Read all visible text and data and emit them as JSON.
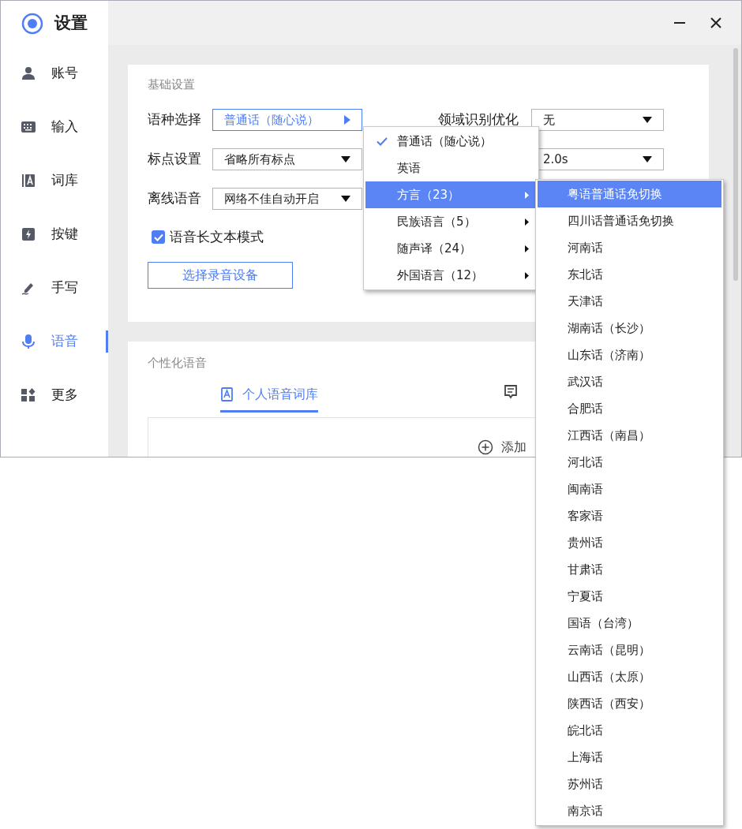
{
  "app": {
    "title": "设置"
  },
  "sidebar": {
    "items": [
      {
        "label": "账号",
        "selected": false
      },
      {
        "label": "输入",
        "selected": false
      },
      {
        "label": "词库",
        "selected": false
      },
      {
        "label": "按键",
        "selected": false
      },
      {
        "label": "手写",
        "selected": false
      },
      {
        "label": "语音",
        "selected": true
      },
      {
        "label": "更多",
        "selected": false
      }
    ]
  },
  "basic_settings": {
    "title": "基础设置",
    "fields": [
      {
        "label": "语种选择",
        "value": "普通话（随心说）",
        "expanded": true
      },
      {
        "label": "标点设置",
        "value": "省略所有标点",
        "expanded": false
      },
      {
        "label": "离线语音",
        "value": "网络不佳自动开启",
        "expanded": false
      }
    ],
    "right_fields": [
      {
        "label": "领域识别优化",
        "value": "无"
      },
      {
        "value": "2.0s"
      }
    ],
    "checkbox": {
      "label": "语音长文本模式",
      "checked": true
    },
    "button": "选择录音设备"
  },
  "personal_voice": {
    "title": "个性化语音",
    "tabs": [
      {
        "label": "个人语音词库",
        "selected": true
      },
      {
        "selected": false
      }
    ],
    "add_button": "添加"
  },
  "language_menu": {
    "items": [
      {
        "label": "普通话（随心说）",
        "checked": true,
        "submenu": false,
        "selected": false
      },
      {
        "label": "英语",
        "checked": false,
        "submenu": false,
        "selected": false
      },
      {
        "label": "方言（23）",
        "checked": false,
        "submenu": true,
        "selected": true
      },
      {
        "label": "民族语言（5）",
        "checked": false,
        "submenu": true,
        "selected": false
      },
      {
        "label": "随声译（24）",
        "checked": false,
        "submenu": true,
        "selected": false
      },
      {
        "label": "外国语言（12）",
        "checked": false,
        "submenu": true,
        "selected": false
      }
    ]
  },
  "dialect_submenu": {
    "items": [
      {
        "label": "粤语普通话免切换",
        "selected": true
      },
      {
        "label": "四川话普通话免切换",
        "selected": false
      },
      {
        "label": "河南话",
        "selected": false
      },
      {
        "label": "东北话",
        "selected": false
      },
      {
        "label": "天津话",
        "selected": false
      },
      {
        "label": "湖南话（长沙）",
        "selected": false
      },
      {
        "label": "山东话（济南）",
        "selected": false
      },
      {
        "label": "武汉话",
        "selected": false
      },
      {
        "label": "合肥话",
        "selected": false
      },
      {
        "label": "江西话（南昌）",
        "selected": false
      },
      {
        "label": "河北话",
        "selected": false
      },
      {
        "label": "闽南语",
        "selected": false
      },
      {
        "label": "客家语",
        "selected": false
      },
      {
        "label": "贵州话",
        "selected": false
      },
      {
        "label": "甘肃话",
        "selected": false
      },
      {
        "label": "宁夏话",
        "selected": false
      },
      {
        "label": "国语（台湾）",
        "selected": false
      },
      {
        "label": "云南话（昆明）",
        "selected": false
      },
      {
        "label": "山西话（太原）",
        "selected": false
      },
      {
        "label": "陕西话（西安）",
        "selected": false
      },
      {
        "label": "皖北话",
        "selected": false
      },
      {
        "label": "上海话",
        "selected": false
      },
      {
        "label": "苏州话",
        "selected": false
      },
      {
        "label": "南京话",
        "selected": false
      }
    ]
  }
}
